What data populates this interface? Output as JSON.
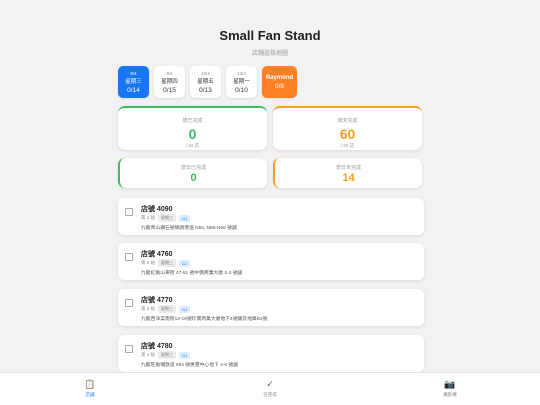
{
  "header": {
    "title": "Small Fan Stand",
    "subtitle": "店舖巡檢地圖"
  },
  "days": [
    {
      "date": "8/4",
      "weekday": "星期三",
      "count": "0/14",
      "active": true
    },
    {
      "date": "9/4",
      "weekday": "星期四",
      "count": "0/15",
      "active": false
    },
    {
      "date": "10/4",
      "weekday": "星期五",
      "count": "0/13",
      "active": false
    },
    {
      "date": "13/4",
      "weekday": "星期一",
      "count": "0/10",
      "active": false
    }
  ],
  "person": {
    "name": "Raymond",
    "count": "0/8"
  },
  "stats": {
    "completed": {
      "label": "總已完成",
      "value": "0",
      "sub": "/ 60 店"
    },
    "pending": {
      "label": "總未完成",
      "value": "60",
      "sub": "/ 60 店"
    },
    "today_done": {
      "label": "當日已完成",
      "value": "0"
    },
    "today_pending": {
      "label": "當日未完成",
      "value": "14"
    }
  },
  "stores": [
    {
      "name": "店號 4090",
      "order": "第 1 站",
      "day_tag": "星期三",
      "code": "GJ",
      "address": "九龍青山鑽石號碼頭港道 N56, N65-N66 號舖"
    },
    {
      "name": "店號 4760",
      "order": "第 2 站",
      "day_tag": "星期三",
      "code": "GJ",
      "address": "九龍紅角山東街 47-51 號中僑商業大廈 2-3 號舖"
    },
    {
      "name": "店號 4770",
      "order": "第 3 站",
      "day_tag": "星期三",
      "code": "GJ",
      "address": "九龍西洋菜南街13-19號珍寶商業大廈地下4號鋪及地庫B2號"
    },
    {
      "name": "店號 4780",
      "order": "第 4 站",
      "day_tag": "星期三",
      "code": "GJ",
      "address": "九龍旺角彌敦道 664 號惠豐中心地下 4-6 號舖"
    }
  ],
  "nav": {
    "list": {
      "label": "店舖",
      "icon": "clipboard-icon"
    },
    "done": {
      "label": "已完成",
      "icon": "check-icon"
    },
    "camera": {
      "label": "攝影機",
      "icon": "camera-icon"
    }
  },
  "colors": {
    "accent": "#1976f2",
    "orange": "#ff7f24",
    "green": "#3cbf5a",
    "amber": "#f5a020"
  }
}
